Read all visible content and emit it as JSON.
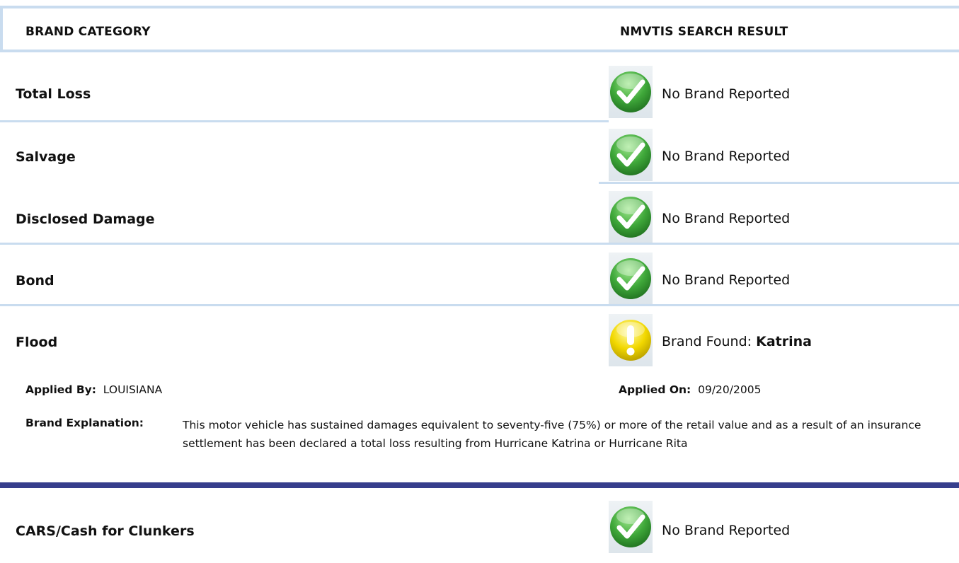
{
  "header": {
    "category_label": "BRAND CATEGORY",
    "result_label": "NMVTIS SEARCH RESULT"
  },
  "brands": [
    {
      "category": "Total Loss",
      "status": "ok",
      "status_icon": "green-check-icon",
      "result_prefix": "No Brand Reported",
      "result_value": ""
    },
    {
      "category": "Salvage",
      "status": "ok",
      "status_icon": "green-check-icon",
      "result_prefix": "No Brand Reported",
      "result_value": ""
    },
    {
      "category": "Disclosed Damage",
      "status": "ok",
      "status_icon": "green-check-icon",
      "result_prefix": "No Brand Reported",
      "result_value": ""
    },
    {
      "category": "Bond",
      "status": "ok",
      "status_icon": "green-check-icon",
      "result_prefix": "No Brand Reported",
      "result_value": ""
    },
    {
      "category": "Flood",
      "status": "warning",
      "status_icon": "yellow-exclamation-icon",
      "result_prefix": "Brand Found: ",
      "result_value": "Katrina"
    },
    {
      "category": "CARS/Cash for Clunkers",
      "status": "ok",
      "status_icon": "green-check-icon",
      "result_prefix": "No Brand Reported",
      "result_value": ""
    }
  ],
  "flood_detail": {
    "applied_by_label": "Applied By:",
    "applied_by_value": "LOUISIANA",
    "applied_on_label": "Applied On:",
    "applied_on_value": "09/20/2005",
    "explanation_label": "Brand Explanation:",
    "explanation_text": "This motor vehicle has sustained damages equivalent to seventy-five (75%) or more of the retail value and as a result of an insurance settlement has been declared a total loss resulting from Hurricane Katrina or Hurricane Rita"
  },
  "colors": {
    "separator": "#c9dcef",
    "section_divider": "#363e8c",
    "ok_green": "#3fa83a",
    "warning_yellow": "#f2d800"
  }
}
